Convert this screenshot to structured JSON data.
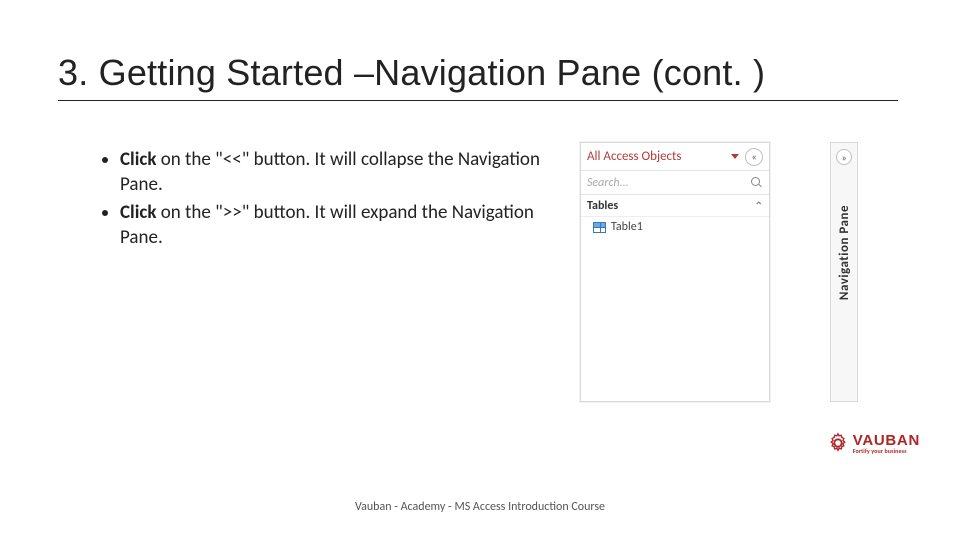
{
  "title": "3. Getting Started –Navigation Pane (cont. )",
  "bullets": {
    "b1": {
      "bold": "Click",
      "rest": " on the \"<<\" button. It will collapse the Navigation Pane."
    },
    "b2": {
      "bold": "Click",
      "rest": " on the \">>\" button. It will expand the Navigation Pane."
    }
  },
  "navpane": {
    "header_label": "All Access Objects",
    "collapse_glyph": "«",
    "search_placeholder": "Search...",
    "group_label": "Tables",
    "item_label": "Table1"
  },
  "collapsed": {
    "expand_glyph": "»",
    "vertical_label": "Navigation Pane"
  },
  "logo": {
    "name": "VAUBAN",
    "tagline": "Fortify your business"
  },
  "footer": "Vauban - Academy - MS Access Introduction Course"
}
